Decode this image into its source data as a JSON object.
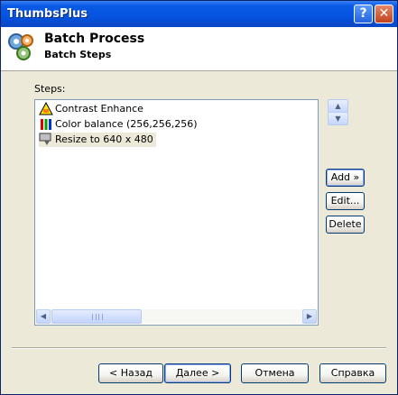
{
  "window": {
    "title": "ThumbsPlus",
    "help_label": "?",
    "close_label": "✕"
  },
  "header": {
    "title": "Batch Process",
    "subtitle": "Batch Steps",
    "icon": "gears-icon"
  },
  "steps": {
    "label": "Steps:",
    "items": [
      {
        "label": "Contrast Enhance",
        "icon": "contrast-icon",
        "selected": false
      },
      {
        "label": "Color balance (256,256,256)",
        "icon": "color-bars-icon",
        "selected": false
      },
      {
        "label": "Resize to 640 x 480",
        "icon": "resize-icon",
        "selected": true
      }
    ]
  },
  "side_buttons": {
    "move_up": "▲",
    "move_down": "▼",
    "add": "Add »",
    "edit": "Edit...",
    "delete": "Delete"
  },
  "scrollbar": {
    "left_arrow": "◀",
    "right_arrow": "▶"
  },
  "footer": {
    "back": "< Назад",
    "next": "Далее >",
    "cancel": "Отмена",
    "help": "Справка"
  },
  "colors": {
    "titlebar": "#0553e0",
    "face": "#ece9d8",
    "header_bg": "#ffffff",
    "border": "#003c74"
  }
}
